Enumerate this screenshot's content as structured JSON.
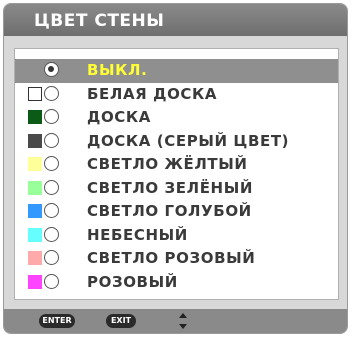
{
  "window": {
    "title": "ЦВЕТ СТЕНЫ"
  },
  "options": [
    {
      "label": "ВЫКЛ.",
      "swatch": null,
      "selected": true
    },
    {
      "label": "БЕЛАЯ ДОСКА",
      "swatch": "#ffffff",
      "selected": false
    },
    {
      "label": "ДОСКА",
      "swatch": "#0b5a16",
      "selected": false
    },
    {
      "label": "ДОСКА (СЕРЫЙ ЦВЕТ)",
      "swatch": "#4a4a4a",
      "selected": false
    },
    {
      "label": "СВЕТЛО ЖЁЛТЫЙ",
      "swatch": "#ffff99",
      "selected": false
    },
    {
      "label": "СВЕТЛО ЗЕЛЁНЫЙ",
      "swatch": "#99ff99",
      "selected": false
    },
    {
      "label": "СВЕТЛО ГОЛУБОЙ",
      "swatch": "#3399ff",
      "selected": false
    },
    {
      "label": "НЕБЕСНЫЙ",
      "swatch": "#66ffff",
      "selected": false
    },
    {
      "label": "СВЕТЛО РОЗОВЫЙ",
      "swatch": "#ffaaaa",
      "selected": false
    },
    {
      "label": "РОЗОВЫЙ",
      "swatch": "#ff44ff",
      "selected": false
    }
  ],
  "footer": {
    "enter_label": "ENTER",
    "exit_label": "EXIT",
    "nav_icon": "up-down-arrows-icon"
  },
  "colors": {
    "selected_text": "#ffff33",
    "selected_row": "#8f8f8f",
    "titlebar": "#7a7a7a"
  }
}
